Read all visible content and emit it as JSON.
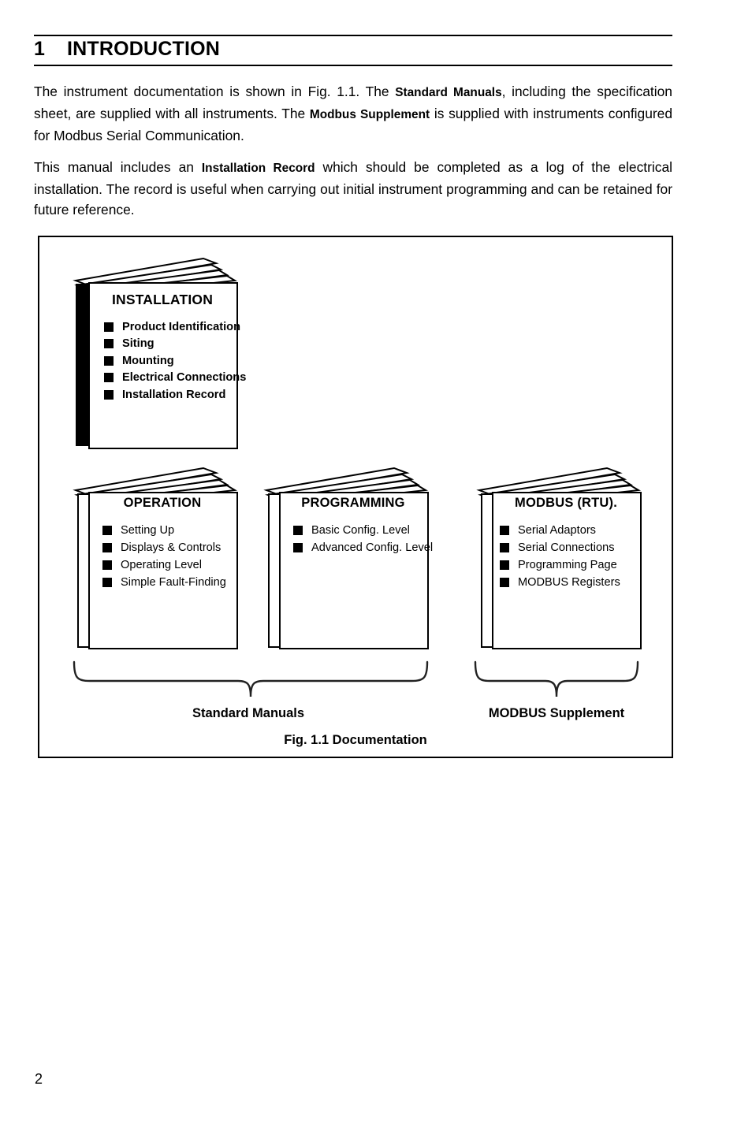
{
  "page": {
    "number": "2"
  },
  "heading": {
    "number": "1",
    "title": "INTRODUCTION"
  },
  "body": {
    "paragraph1_part1": "The instrument documentation is shown in Fig. 1.1. The ",
    "paragraph1_bold1": "Standard Manuals",
    "paragraph1_part2": ",  including the specification sheet, are supplied with all instruments. The ",
    "paragraph1_bold2": "Modbus Supplement",
    "paragraph1_part3": " is supplied with instruments configured for Modbus Serial Communication.",
    "paragraph2_part1": "This manual includes an ",
    "paragraph2_bold1": "Installation Record",
    "paragraph2_part2": " which should be completed as a log of the electrical installation. The record is useful when carrying out initial instrument programming and can be retained for future reference."
  },
  "figure": {
    "caption": "Fig. 1.1 Documentation",
    "group_labels": {
      "standard": "Standard Manuals",
      "modbus": "MODBUS Supplement"
    },
    "books": [
      {
        "id": "installation",
        "title": "INSTALLATION",
        "items": [
          "Product Identification",
          "Siting",
          "Mounting",
          "Electrical Connections",
          "Installation Record"
        ]
      },
      {
        "id": "operation",
        "title": "OPERATION",
        "items": [
          "Setting Up",
          "Displays & Controls",
          "Operating Level",
          "Simple Fault-Finding"
        ]
      },
      {
        "id": "programming",
        "title": "PROGRAMMING",
        "items": [
          "Basic Config. Level",
          "Advanced Config. Level"
        ]
      },
      {
        "id": "modbus",
        "title": "MODBUS (RTU).",
        "items": [
          "Serial Adaptors",
          "Serial Connections",
          "Programming Page",
          "MODBUS Registers"
        ]
      }
    ]
  },
  "colors": {
    "ink": "#000000",
    "paper": "#ffffff"
  }
}
